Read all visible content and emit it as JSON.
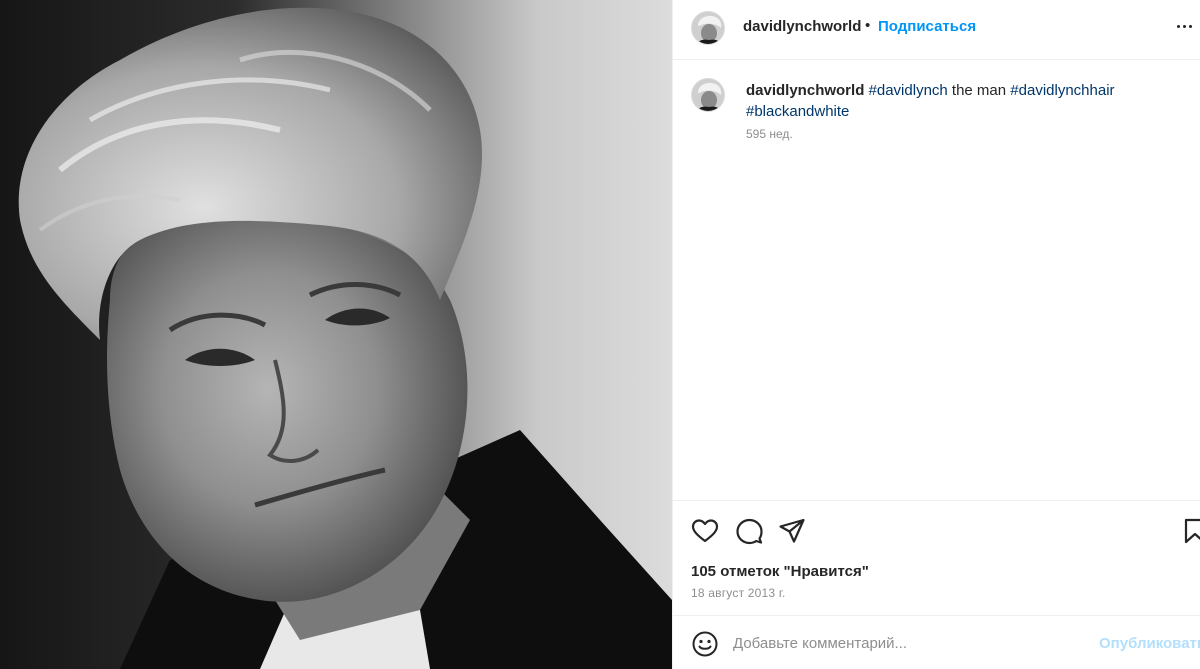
{
  "photo": {
    "description_icon": "portrait-photo"
  },
  "header": {
    "username": "davidlynchworld",
    "separator": "•",
    "follow_label": "Подписаться"
  },
  "caption": {
    "username": "davidlynchworld",
    "tag_1": "#davidlynch",
    "text_1": " the man ",
    "tag_2": "#davidlynchhair",
    "tag_3": "#blackandwhite",
    "time": "595 нед."
  },
  "actions": {
    "like_icon": "heart-icon",
    "comment_icon": "comment-icon",
    "share_icon": "paper-plane-icon",
    "save_icon": "bookmark-icon",
    "likes_text": "105 отметок \"Нравится\"",
    "date": "18 август 2013 г."
  },
  "comment": {
    "placeholder": "Добавьте комментарий...",
    "publish_label": "Опубликовать"
  },
  "colors": {
    "accent": "#0095f6",
    "hashtag": "#00376b",
    "muted": "#8e8e8e",
    "publish_disabled": "#b2dffc"
  }
}
